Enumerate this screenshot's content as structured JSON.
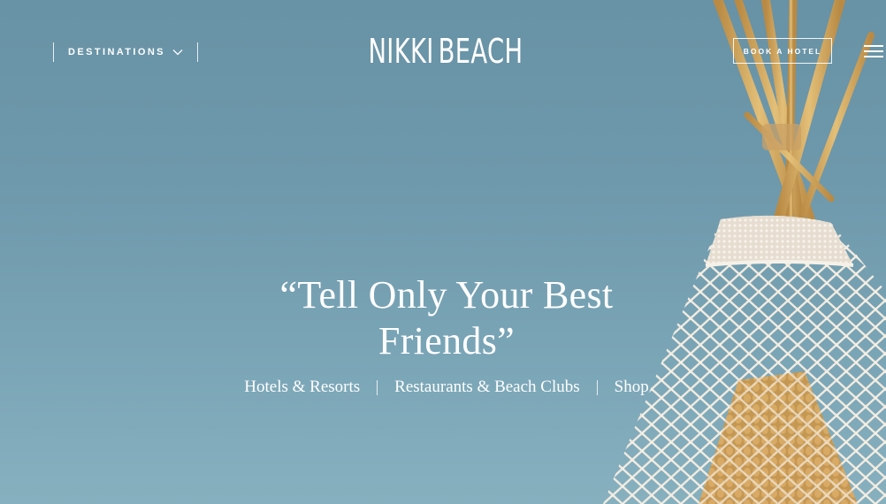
{
  "header": {
    "destinations_label": "DESTINATIONS",
    "logo_left": "NIKKI",
    "logo_right": "BEACH",
    "book_label": "BOOK A HOTEL"
  },
  "hero": {
    "headline_line1": "“Tell Only Your Best",
    "headline_line2": "Friends”",
    "links": [
      "Hotels & Resorts",
      "Restaurants & Beach Clubs",
      "Shop"
    ]
  },
  "icons": {
    "destinations": "chevron-down-icon",
    "logo": "teepee-logo-icon",
    "menu": "hamburger-menu-icon"
  },
  "colors": {
    "sky": "#6e98ab",
    "text": "#ffffff",
    "macrame": "#efe8dc",
    "poles": "#d2a95e"
  }
}
